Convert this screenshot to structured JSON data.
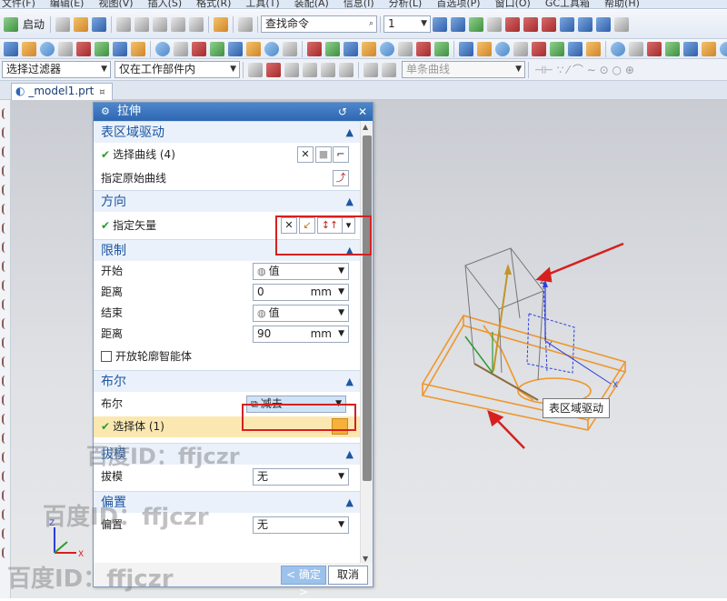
{
  "menubar": [
    "文件(F)",
    "编辑(E)",
    "视图(V)",
    "插入(S)",
    "格式(R)",
    "工具(T)",
    "装配(A)",
    "信息(I)",
    "分析(L)",
    "首选项(P)",
    "窗口(O)",
    "GC工具箱",
    "帮助(H)"
  ],
  "toolbar": {
    "start_label": "启动",
    "command_search_placeholder": "查找命令",
    "layer_value": "1",
    "filter_value": "选择过滤器",
    "scope_value": "仅在工作部件内",
    "curve_rule_value": "单条曲线"
  },
  "file_tab": {
    "label": "_model1.prt",
    "pin": "¤",
    "close": "×"
  },
  "dialog": {
    "title": "拉伸",
    "sections": {
      "surface_drive": {
        "header": "表区域驱动",
        "select_curve": "选择曲线 (4)",
        "specify_original_curve": "指定原始曲线"
      },
      "direction": {
        "header": "方向",
        "specify_vector": "指定矢量"
      },
      "limits": {
        "header": "限制",
        "start_label": "开始",
        "start_value": "值",
        "distance1_label": "距离",
        "distance1_value": "0",
        "distance1_unit": "mm",
        "end_label": "结束",
        "end_value": "值",
        "distance2_label": "距离",
        "distance2_value": "90",
        "distance2_unit": "mm",
        "open_profile_label": "开放轮廓智能体"
      },
      "boolean": {
        "header": "布尔",
        "boolean_label": "布尔",
        "boolean_value": "减去",
        "select_body": "选择体 (1)"
      },
      "draft": {
        "header": "拔模",
        "draft_label": "拔模",
        "draft_value": "无"
      },
      "offset": {
        "header": "偏置",
        "offset_label": "偏置",
        "offset_value": "无"
      }
    },
    "ok_label": "< 确定 >",
    "cancel_label": "取消"
  },
  "viewport": {
    "tooltip": "表区域驱动",
    "axis_x": "X",
    "axis_y": "Y",
    "axis_z": "Z"
  },
  "watermark": "百度ID：ffjczr",
  "colors": {
    "accent": "#2e67b1",
    "highlight_box": "#d62020",
    "sketch": "#f0962a",
    "selection_row": "#fbe8b0"
  }
}
